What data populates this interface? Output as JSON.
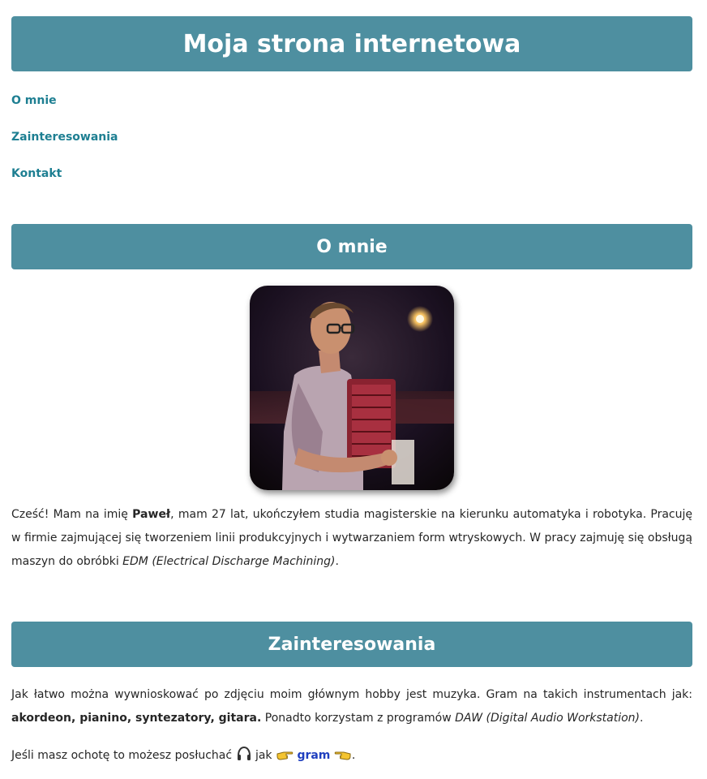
{
  "header": {
    "title": "Moja strona internetowa"
  },
  "nav": {
    "items": [
      {
        "label": "O mnie"
      },
      {
        "label": "Zainteresowania"
      },
      {
        "label": "Kontakt"
      }
    ]
  },
  "about": {
    "heading": "O mnie",
    "photo_description": "man-playing-accordion-photo",
    "p_intro": "Cześć! Mam na imię ",
    "p_name": "Paweł",
    "p_rest": ", mam 27 lat, ukończyłem studia magisterskie na kierunku automatyka i robotyka. Pracuję w firmie zajmującej się tworzeniem linii produkcyjnych i wytwarzaniem form wtryskowych. W pracy zajmuję się obsługą maszyn do obróbki ",
    "p_edm": "EDM (Electrical Discharge Machining)",
    "p_end": "."
  },
  "interests": {
    "heading": "Zainteresowania",
    "p1_intro": "Jak łatwo można wywnioskować po zdjęciu moim głównym hobby jest muzyka. Gram na takich instrumentach jak: ",
    "p1_instruments": "akordeon, pianino, syntezatory, gitara.",
    "p1_mid": " Ponadto korzystam z programów ",
    "p1_daw": "DAW (Digital Audio Workstation)",
    "p1_end": ".",
    "p2_intro": "Jeśli masz ochotę to możesz posłuchać ",
    "p2_mid": " jak ",
    "p2_link": "gram",
    "p2_end": "."
  },
  "colors": {
    "banner": "#4e8fa0",
    "nav_link": "#1e7f92",
    "gram_link": "#1f3fbf"
  },
  "icons": [
    "headphones-icon",
    "pointing-right-hand-icon",
    "pointing-left-hand-icon"
  ]
}
